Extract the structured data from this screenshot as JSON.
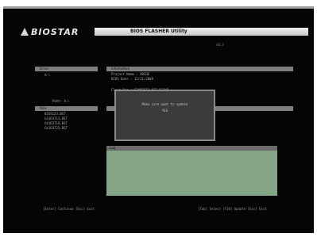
{
  "header": {
    "brand": "BIOSTAR",
    "title": "BIOS FLASHER Utility",
    "version": "v8.3"
  },
  "panels": {
    "drive": {
      "title": "Drive",
      "items": [
        "A:\\"
      ]
    },
    "info": {
      "title": "Information",
      "lines": [
        "Project Name : ABCDE",
        "BIOS Date    : 12/11/2009",
        "Flash Rom    : S28DE512 SST 512KB"
      ]
    },
    "path": {
      "label": "Path: A:\\"
    },
    "files": {
      "title": "Files",
      "items": [
        "BIOS123.BST",
        "G41D3712.BST",
        "G41D3718.BST",
        "G41D3722.BST"
      ]
    },
    "log": {
      "title": "Log"
    }
  },
  "dialog": {
    "message": "Make sure want to update",
    "value": "YES"
  },
  "footer": {
    "left": "[Enter] Continue  [Esc] Exit",
    "right": "[Tab] Select  [F10] Update  [Esc] Exit"
  },
  "colors": {
    "screen": "#050505",
    "panel_title": "#7f7f7f",
    "dialog_bg": "#3b3b3b",
    "log_bg": "#85a686"
  }
}
